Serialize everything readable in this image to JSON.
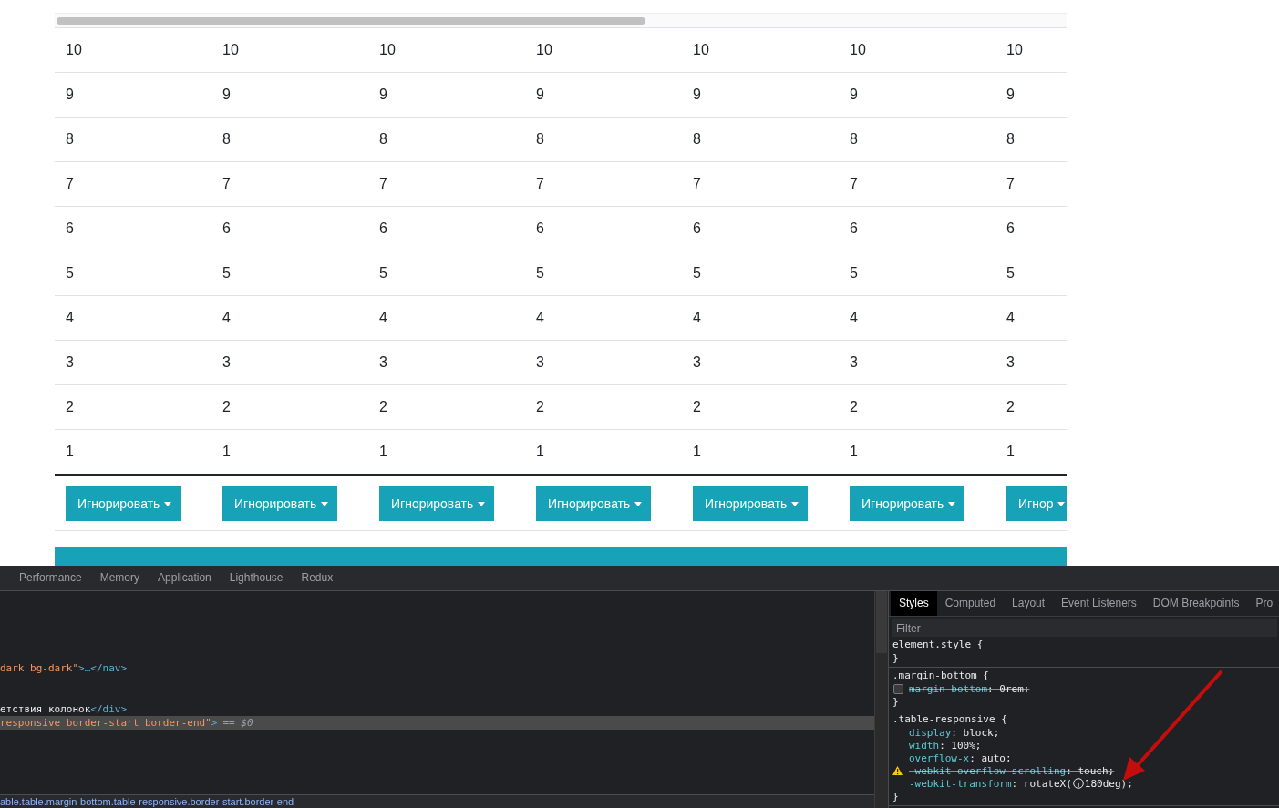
{
  "page": {
    "table": {
      "rows": [
        [
          "10",
          "10",
          "10",
          "10",
          "10",
          "10",
          "10"
        ],
        [
          "9",
          "9",
          "9",
          "9",
          "9",
          "9",
          "9"
        ],
        [
          "8",
          "8",
          "8",
          "8",
          "8",
          "8",
          "8"
        ],
        [
          "7",
          "7",
          "7",
          "7",
          "7",
          "7",
          "7"
        ],
        [
          "6",
          "6",
          "6",
          "6",
          "6",
          "6",
          "6"
        ],
        [
          "5",
          "5",
          "5",
          "5",
          "5",
          "5",
          "5"
        ],
        [
          "4",
          "4",
          "4",
          "4",
          "4",
          "4",
          "4"
        ],
        [
          "3",
          "3",
          "3",
          "3",
          "3",
          "3",
          "3"
        ],
        [
          "2",
          "2",
          "2",
          "2",
          "2",
          "2",
          "2"
        ],
        [
          "1",
          "1",
          "1",
          "1",
          "1",
          "1",
          "1"
        ]
      ],
      "button_row": [
        {
          "button": "Игнорировать"
        },
        {
          "button": "Игнорировать"
        },
        {
          "button": "Игнорировать"
        },
        {
          "button": "Игнорировать"
        },
        {
          "button": "Игнорировать"
        },
        {
          "button": "Игнорировать"
        },
        {
          "button": "Игнор"
        }
      ]
    }
  },
  "devtools": {
    "tabs": [
      {
        "label": "Performance",
        "selected": false
      },
      {
        "label": "Memory",
        "selected": false
      },
      {
        "label": "Application",
        "selected": false
      },
      {
        "label": "Lighthouse",
        "selected": false
      },
      {
        "label": "Redux",
        "selected": false
      }
    ],
    "elements": {
      "lines": [
        {
          "selected": false,
          "segments": [
            {
              "kind": "attr-value",
              "text": "dark bg-dark\""
            },
            {
              "kind": "tag",
              "text": ">…</nav>"
            }
          ]
        },
        {
          "selected": false,
          "segments": [
            {
              "kind": "text",
              "text": "етствия колонок"
            },
            {
              "kind": "tag",
              "text": "</div>"
            }
          ]
        },
        {
          "selected": true,
          "segments": [
            {
              "kind": "attr-value",
              "text": "responsive border-start border-end\""
            },
            {
              "kind": "tag",
              "text": ">"
            },
            {
              "kind": "hint",
              "text": "== $0"
            }
          ]
        }
      ],
      "breadcrumb": "able.table.margin-bottom.table-responsive.border-start.border-end"
    },
    "styles_tabs": [
      {
        "label": "Styles",
        "selected": true
      },
      {
        "label": "Computed",
        "selected": false
      },
      {
        "label": "Layout",
        "selected": false
      },
      {
        "label": "Event Listeners",
        "selected": false
      },
      {
        "label": "DOM Breakpoints",
        "selected": false
      },
      {
        "label": "Pro",
        "selected": false
      }
    ],
    "filter": {
      "placeholder": "Filter"
    },
    "rules": [
      {
        "selector": "element.style {",
        "close": "}"
      },
      {
        "selector": ".margin-bottom {",
        "close": "}",
        "declarations": [
          {
            "kind": "toggle",
            "checked": false,
            "property": "margin-bottom",
            "value": ": 0rem;",
            "struck": true,
            "warning": false
          }
        ]
      },
      {
        "selector": ".table-responsive {",
        "close": "}",
        "declarations": [
          {
            "kind": "plain",
            "property": "display",
            "value": ": block;",
            "struck": false,
            "warning": false
          },
          {
            "kind": "plain",
            "property": "width",
            "value": ": 100%;",
            "struck": false,
            "warning": false
          },
          {
            "kind": "plain",
            "property": "overflow-x",
            "value": ": auto;",
            "struck": false,
            "warning": false
          },
          {
            "kind": "plain",
            "property": "-webkit-overflow-scrolling",
            "value": ": touch;",
            "struck": true,
            "warning": true
          },
          {
            "kind": "angle",
            "property": "-webkit-transform",
            "value": ": rotateX(",
            "value_after": "180deg);",
            "struck": false,
            "warning": false
          }
        ]
      }
    ]
  }
}
